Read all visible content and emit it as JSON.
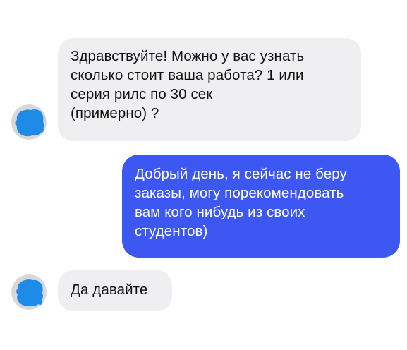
{
  "conversation": {
    "messages": [
      {
        "sender": "incoming",
        "lines": [
          "Здравствуйте! Можно у вас узнать",
          "сколько стоит ваша работа? 1 или",
          "серия рилс по 30 сек",
          "(примерно) ?"
        ]
      },
      {
        "sender": "outgoing",
        "lines": [
          "Добрый день, я сейчас не беру",
          "заказы, могу порекомендовать",
          "вам кого нибудь из своих",
          "студентов)"
        ]
      },
      {
        "sender": "incoming",
        "lines": [
          "Да давайте"
        ]
      }
    ],
    "avatars": [
      {
        "icon": "contact-avatar-icon",
        "state": "blurred"
      },
      {
        "icon": "contact-avatar-icon",
        "state": "blurred"
      }
    ]
  },
  "colors": {
    "incoming_bubble": "#efeff1",
    "outgoing_bubble": "#3d57f3",
    "incoming_text": "#111111",
    "outgoing_text": "#ffffff",
    "avatar_mask": "#1f8be8"
  }
}
